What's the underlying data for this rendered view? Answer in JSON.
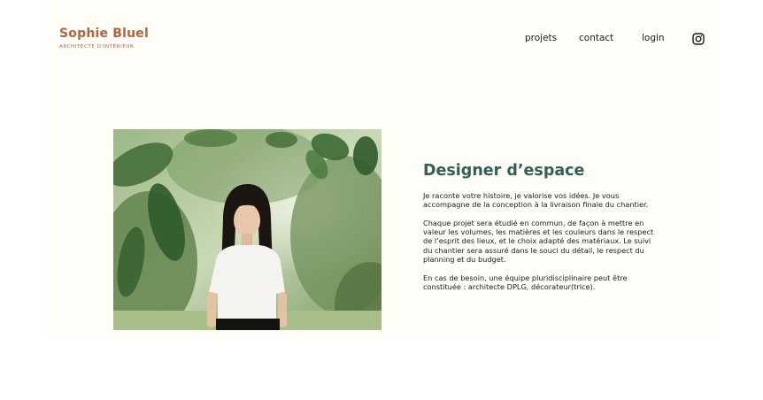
{
  "header": {
    "brand_name": "Sophie Bluel",
    "brand_subtitle": "ARCHITECTE D'INTÉRIEUR",
    "nav": {
      "projets": "projets",
      "contact": "contact",
      "login": "login"
    },
    "social_icon": "instagram-icon"
  },
  "intro": {
    "photo_alt": "portrait-photo",
    "title": "Designer d’espace",
    "paragraphs": [
      "Je raconte votre histoire, je valorise vos idées. Je vous accompagne de la conception à la livraison finale du chantier.",
      "Chaque projet sera étudié en commun, de façon à mettre en valeur les volumes, les matières et les couleurs dans le respect de l’esprit des lieux, et le choix adapté des matériaux. Le suivi du chantier sera assuré dans le souci du détail, le respect du planning et du budget.",
      "En cas de besoin, une équipe pluridisciplinaire peut être constituée : architecte DPLG, décorateur(trice)."
    ]
  },
  "colors": {
    "brand": "#b1663c",
    "title": "#2f6254",
    "page_background": "#fefdf7",
    "text": "#1d1d1b"
  }
}
